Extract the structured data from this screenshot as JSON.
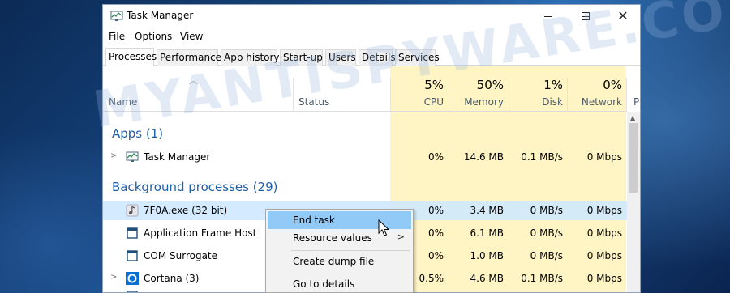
{
  "window": {
    "title": "Task Manager",
    "icon": "task-manager-icon",
    "controls": [
      "minimize-icon",
      "maximize-icon",
      "close-icon"
    ]
  },
  "menu": [
    "File",
    "Options",
    "View"
  ],
  "tabs": [
    "Processes",
    "Performance",
    "App history",
    "Start-up",
    "Users",
    "Details",
    "Services"
  ],
  "active_tab": "Processes",
  "columns": {
    "name": "Name",
    "status": "Status",
    "cpu": {
      "pct": "5%",
      "label": "CPU"
    },
    "memory": {
      "pct": "50%",
      "label": "Memory"
    },
    "disk": {
      "pct": "1%",
      "label": "Disk"
    },
    "network": {
      "pct": "0%",
      "label": "Network"
    },
    "truncated": "P"
  },
  "groups": {
    "apps": "Apps (1)",
    "background": "Background processes (29)"
  },
  "apps": [
    {
      "name": "Task Manager",
      "cpu": "0%",
      "memory": "14.6 MB",
      "disk": "0.1 MB/s",
      "network": "0 Mbps"
    }
  ],
  "background": [
    {
      "name": "7F0A.exe (32 bit)",
      "cpu": "0%",
      "memory": "3.4 MB",
      "disk": "0 MB/s",
      "network": "0 Mbps"
    },
    {
      "name": "Application Frame Host",
      "cpu": "0%",
      "memory": "6.1 MB",
      "disk": "0 MB/s",
      "network": "0 Mbps"
    },
    {
      "name": "COM Surrogate",
      "cpu": "0%",
      "memory": "1.0 MB",
      "disk": "0 MB/s",
      "network": "0 Mbps"
    },
    {
      "name": "Cortana (3)",
      "cpu": "0.5%",
      "memory": "4.6 MB",
      "disk": "0.1 MB/s",
      "network": "0 Mbps"
    }
  ],
  "context_menu": [
    "End task",
    "Resource values",
    "Create dump file",
    "Go to details"
  ],
  "watermark": "MYANTISPYWARE.COM",
  "colors": {
    "accent": "#1f5fa8",
    "heat": "#fff4c4",
    "selected": "#cce8ff",
    "menu_highlight": "#91c9f7"
  }
}
